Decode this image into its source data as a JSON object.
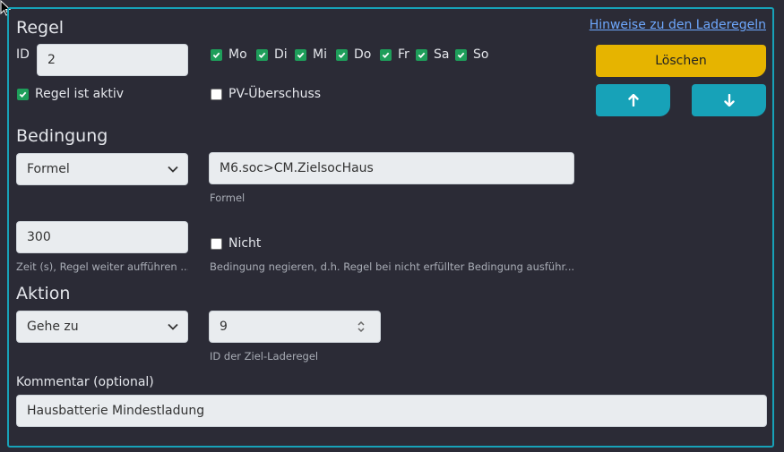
{
  "rule": {
    "heading": "Regel",
    "id_label": "ID",
    "id_value": "2",
    "active_label": "Regel ist aktiv",
    "active_checked": true,
    "pv_label": "PV-Überschuss",
    "pv_checked": false,
    "days": [
      {
        "label": "Mo",
        "checked": true
      },
      {
        "label": "Di",
        "checked": true
      },
      {
        "label": "Mi",
        "checked": true
      },
      {
        "label": "Do",
        "checked": true
      },
      {
        "label": "Fr",
        "checked": true
      },
      {
        "label": "Sa",
        "checked": true
      },
      {
        "label": "So",
        "checked": true
      }
    ]
  },
  "actions": {
    "help_link": "Hinweise zu den Laderegeln",
    "delete_label": "Löschen",
    "up_icon": "arrow-up-icon",
    "down_icon": "arrow-down-icon"
  },
  "condition": {
    "heading": "Bedingung",
    "type_value": "Formel",
    "formula_value": "M6.soc>CM.ZielsocHaus",
    "formula_hint": "Formel",
    "time_value": "300",
    "time_hint": "Zeit (s), Regel weiter aufführen ...",
    "negate_label": "Nicht",
    "negate_checked": false,
    "negate_hint": "Bedingung negieren, d.h. Regel bei nicht erfüllter Bedingung ausführ..."
  },
  "action": {
    "heading": "Aktion",
    "type_value": "Gehe zu",
    "target_value": "9",
    "target_hint": "ID der Ziel-Laderegel"
  },
  "comment": {
    "label": "Kommentar (optional)",
    "value": "Hausbatterie Mindestladung"
  },
  "colors": {
    "background": "#2b2b36",
    "panel_border": "#17a2b8",
    "delete_button": "#e6b400",
    "arrow_button": "#17a2b8",
    "checkbox_checked": "#1e9e5a",
    "link": "#6ea8fe"
  }
}
